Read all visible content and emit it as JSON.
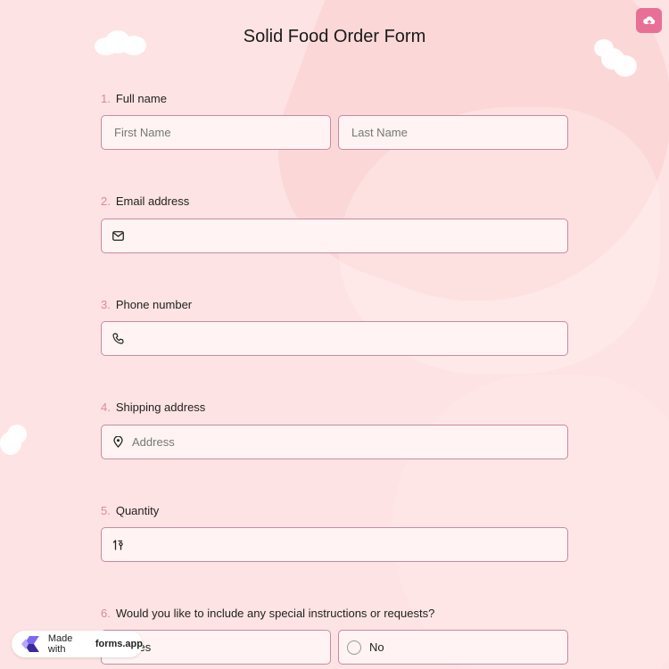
{
  "form": {
    "title": "Solid Food Order Form"
  },
  "questions": [
    {
      "number": "1.",
      "label": "Full name",
      "first_placeholder": "First Name",
      "last_placeholder": "Last Name"
    },
    {
      "number": "2.",
      "label": "Email address",
      "placeholder": ""
    },
    {
      "number": "3.",
      "label": "Phone number",
      "placeholder": ""
    },
    {
      "number": "4.",
      "label": "Shipping address",
      "placeholder": "Address"
    },
    {
      "number": "5.",
      "label": "Quantity",
      "placeholder": ""
    },
    {
      "number": "6.",
      "label": "Would you like to include any special instructions or requests?",
      "options": [
        "Yes",
        "No"
      ]
    }
  ],
  "badge": {
    "prefix": "Made with",
    "brand": "forms.app"
  },
  "colors": {
    "accent": "#e86f96",
    "border": "#c78aa8",
    "background": "#fde3e3"
  },
  "icons": [
    "cloud-upload-icon",
    "mail-icon",
    "phone-icon",
    "map-pin-icon",
    "number-icon",
    "radio-icon"
  ]
}
